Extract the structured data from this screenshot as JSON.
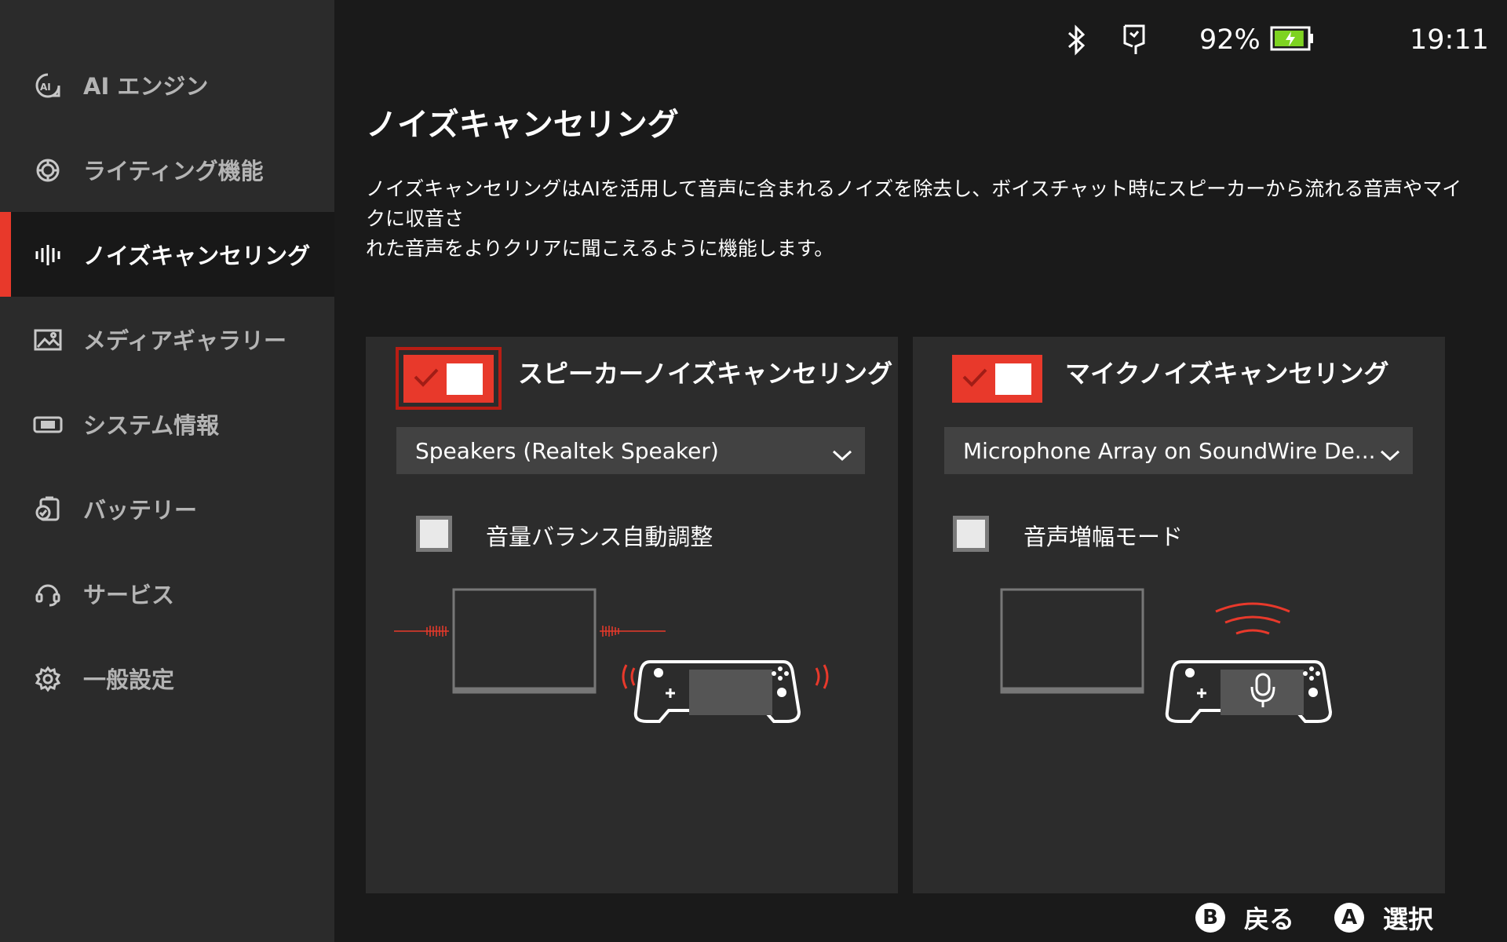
{
  "sidebar": {
    "items": [
      {
        "label": "AI エンジン",
        "icon": "ai-icon"
      },
      {
        "label": "ライティング機能",
        "icon": "lighting-icon"
      },
      {
        "label": "ノイズキャンセリング",
        "icon": "noise-wave-icon",
        "active": true
      },
      {
        "label": "メディアギャラリー",
        "icon": "image-icon"
      },
      {
        "label": "システム情報",
        "icon": "device-icon"
      },
      {
        "label": "バッテリー",
        "icon": "battery-check-icon"
      },
      {
        "label": "サービス",
        "icon": "headset-icon"
      },
      {
        "label": "一般設定",
        "icon": "gear-icon"
      }
    ]
  },
  "status": {
    "battery_percent": "92%",
    "battery_level": 0.92,
    "time": "19:11",
    "battery_color": "#7ed321"
  },
  "main": {
    "title": "ノイズキャンセリング",
    "description_line1": "ノイズキャンセリングはAIを活用して音声に含まれるノイズを除去し、ボイスチャット時にスピーカーから流れる音声やマイクに収音さ",
    "description_line2": "れた音声をよりクリアに聞こえるように機能します。"
  },
  "speaker_card": {
    "title": "スピーカーノイズキャンセリング",
    "toggle_on": true,
    "device": "Speakers (Realtek Speaker)",
    "checkbox_label": "音量バランス自動調整",
    "checkbox_checked": false
  },
  "mic_card": {
    "title": "マイクノイズキャンセリング",
    "toggle_on": true,
    "device": "Microphone Array on SoundWire De...",
    "checkbox_label": "音声増幅モード",
    "checkbox_checked": false
  },
  "footer": {
    "back_key": "B",
    "back_label": "戻る",
    "select_key": "A",
    "select_label": "選択"
  },
  "colors": {
    "accent": "#e8392b",
    "sidebar_bg": "#2b2b2b",
    "card_bg": "#2c2c2c"
  }
}
